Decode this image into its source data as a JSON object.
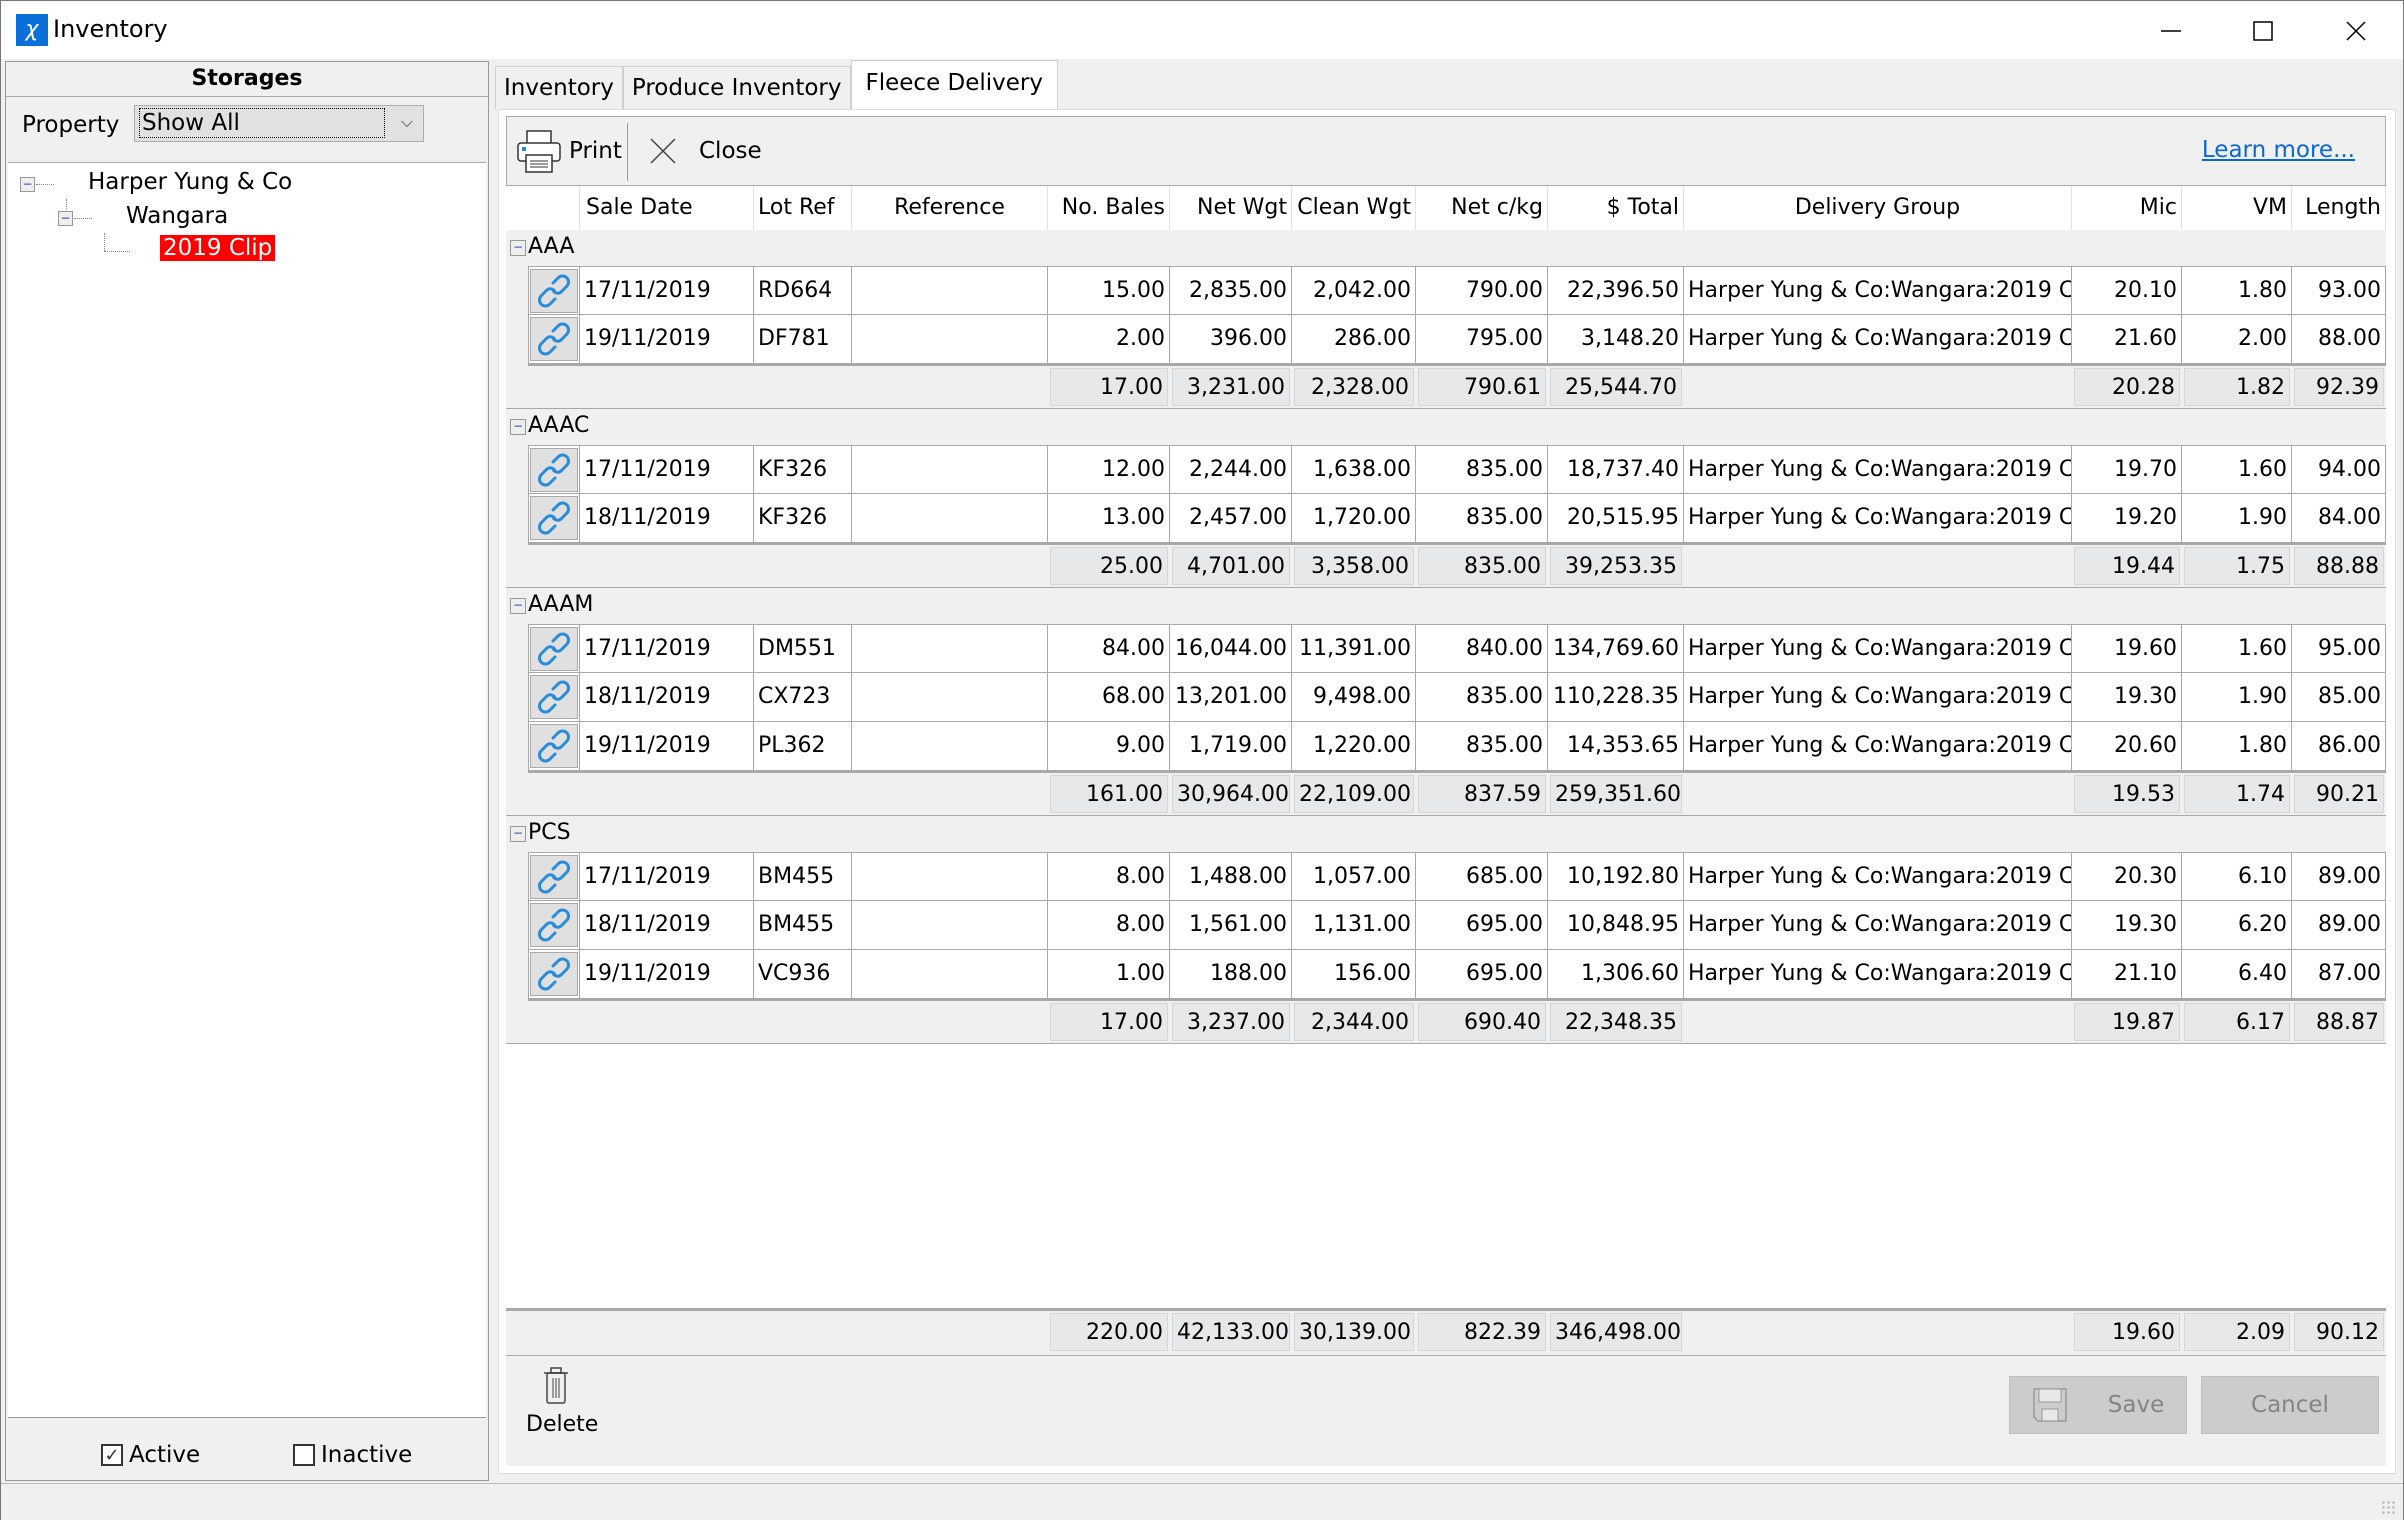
{
  "window": {
    "title": "Inventory",
    "icon": "app-logo-icon",
    "controls": [
      "minimize-icon",
      "maximize-icon",
      "close-icon"
    ]
  },
  "left_panel": {
    "header": "Storages",
    "property_label": "Property",
    "property_value": "Show All",
    "tree": [
      {
        "label": "Harper Yung & Co",
        "level": 0,
        "expanded": true
      },
      {
        "label": "Wangara",
        "level": 1,
        "expanded": true
      },
      {
        "label": "2019 Clip",
        "level": 2,
        "selected": true
      }
    ],
    "active_label": "Active",
    "active_checked": true,
    "inactive_label": "Inactive",
    "inactive_checked": false
  },
  "tabs": [
    {
      "label": "Inventory",
      "active": false
    },
    {
      "label": "Produce Inventory",
      "active": false
    },
    {
      "label": "Fleece Delivery",
      "active": true
    }
  ],
  "toolbar": {
    "print_label": "Print",
    "close_label": "Close",
    "learn_more": "Learn more..."
  },
  "columns": [
    "",
    "Sale Date",
    "Lot Ref",
    "Reference",
    "No. Bales",
    "Net Wgt",
    "Clean Wgt",
    "Net c/kg",
    "$ Total",
    "Delivery Group",
    "Mic",
    "VM",
    "Length"
  ],
  "groups": [
    {
      "name": "AAA",
      "rows": [
        {
          "date": "17/11/2019",
          "lot": "RD664",
          "ref": "",
          "bales": "15.00",
          "net": "2,835.00",
          "clean": "2,042.00",
          "ckg": "790.00",
          "total": "22,396.50",
          "group": "Harper Yung & Co:Wangara:2019 C",
          "mic": "20.10",
          "vm": "1.80",
          "len": "93.00"
        },
        {
          "date": "19/11/2019",
          "lot": "DF781",
          "ref": "",
          "bales": "2.00",
          "net": "396.00",
          "clean": "286.00",
          "ckg": "795.00",
          "total": "3,148.20",
          "group": "Harper Yung & Co:Wangara:2019 C",
          "mic": "21.60",
          "vm": "2.00",
          "len": "88.00"
        }
      ],
      "subtotal": {
        "bales": "17.00",
        "net": "3,231.00",
        "clean": "2,328.00",
        "ckg": "790.61",
        "total": "25,544.70",
        "mic": "20.28",
        "vm": "1.82",
        "len": "92.39"
      }
    },
    {
      "name": "AAAC",
      "rows": [
        {
          "date": "17/11/2019",
          "lot": "KF326",
          "ref": "",
          "bales": "12.00",
          "net": "2,244.00",
          "clean": "1,638.00",
          "ckg": "835.00",
          "total": "18,737.40",
          "group": "Harper Yung & Co:Wangara:2019 C",
          "mic": "19.70",
          "vm": "1.60",
          "len": "94.00"
        },
        {
          "date": "18/11/2019",
          "lot": "KF326",
          "ref": "",
          "bales": "13.00",
          "net": "2,457.00",
          "clean": "1,720.00",
          "ckg": "835.00",
          "total": "20,515.95",
          "group": "Harper Yung & Co:Wangara:2019 C",
          "mic": "19.20",
          "vm": "1.90",
          "len": "84.00"
        }
      ],
      "subtotal": {
        "bales": "25.00",
        "net": "4,701.00",
        "clean": "3,358.00",
        "ckg": "835.00",
        "total": "39,253.35",
        "mic": "19.44",
        "vm": "1.75",
        "len": "88.88"
      }
    },
    {
      "name": "AAAM",
      "rows": [
        {
          "date": "17/11/2019",
          "lot": "DM551",
          "ref": "",
          "bales": "84.00",
          "net": "16,044.00",
          "clean": "11,391.00",
          "ckg": "840.00",
          "total": "134,769.60",
          "group": "Harper Yung & Co:Wangara:2019 C",
          "mic": "19.60",
          "vm": "1.60",
          "len": "95.00"
        },
        {
          "date": "18/11/2019",
          "lot": "CX723",
          "ref": "",
          "bales": "68.00",
          "net": "13,201.00",
          "clean": "9,498.00",
          "ckg": "835.00",
          "total": "110,228.35",
          "group": "Harper Yung & Co:Wangara:2019 C",
          "mic": "19.30",
          "vm": "1.90",
          "len": "85.00"
        },
        {
          "date": "19/11/2019",
          "lot": "PL362",
          "ref": "",
          "bales": "9.00",
          "net": "1,719.00",
          "clean": "1,220.00",
          "ckg": "835.00",
          "total": "14,353.65",
          "group": "Harper Yung & Co:Wangara:2019 C",
          "mic": "20.60",
          "vm": "1.80",
          "len": "86.00"
        }
      ],
      "subtotal": {
        "bales": "161.00",
        "net": "30,964.00",
        "clean": "22,109.00",
        "ckg": "837.59",
        "total": "259,351.60",
        "mic": "19.53",
        "vm": "1.74",
        "len": "90.21"
      }
    },
    {
      "name": "PCS",
      "rows": [
        {
          "date": "17/11/2019",
          "lot": "BM455",
          "ref": "",
          "bales": "8.00",
          "net": "1,488.00",
          "clean": "1,057.00",
          "ckg": "685.00",
          "total": "10,192.80",
          "group": "Harper Yung & Co:Wangara:2019 C",
          "mic": "20.30",
          "vm": "6.10",
          "len": "89.00"
        },
        {
          "date": "18/11/2019",
          "lot": "BM455",
          "ref": "",
          "bales": "8.00",
          "net": "1,561.00",
          "clean": "1,131.00",
          "ckg": "695.00",
          "total": "10,848.95",
          "group": "Harper Yung & Co:Wangara:2019 C",
          "mic": "19.30",
          "vm": "6.20",
          "len": "89.00"
        },
        {
          "date": "19/11/2019",
          "lot": "VC936",
          "ref": "",
          "bales": "1.00",
          "net": "188.00",
          "clean": "156.00",
          "ckg": "695.00",
          "total": "1,306.60",
          "group": "Harper Yung & Co:Wangara:2019 C",
          "mic": "21.10",
          "vm": "6.40",
          "len": "87.00"
        }
      ],
      "subtotal": {
        "bales": "17.00",
        "net": "3,237.00",
        "clean": "2,344.00",
        "ckg": "690.40",
        "total": "22,348.35",
        "mic": "19.87",
        "vm": "6.17",
        "len": "88.87"
      }
    }
  ],
  "grand_total": {
    "bales": "220.00",
    "net": "42,133.00",
    "clean": "30,139.00",
    "ckg": "822.39",
    "total": "346,498.00",
    "mic": "19.60",
    "vm": "2.09",
    "len": "90.12"
  },
  "actions": {
    "delete_label": "Delete",
    "save_label": "Save",
    "cancel_label": "Cancel"
  },
  "colors": {
    "selection": "#ff0000",
    "link": "#0b66d6",
    "link_icon": "#2a8bd8"
  }
}
